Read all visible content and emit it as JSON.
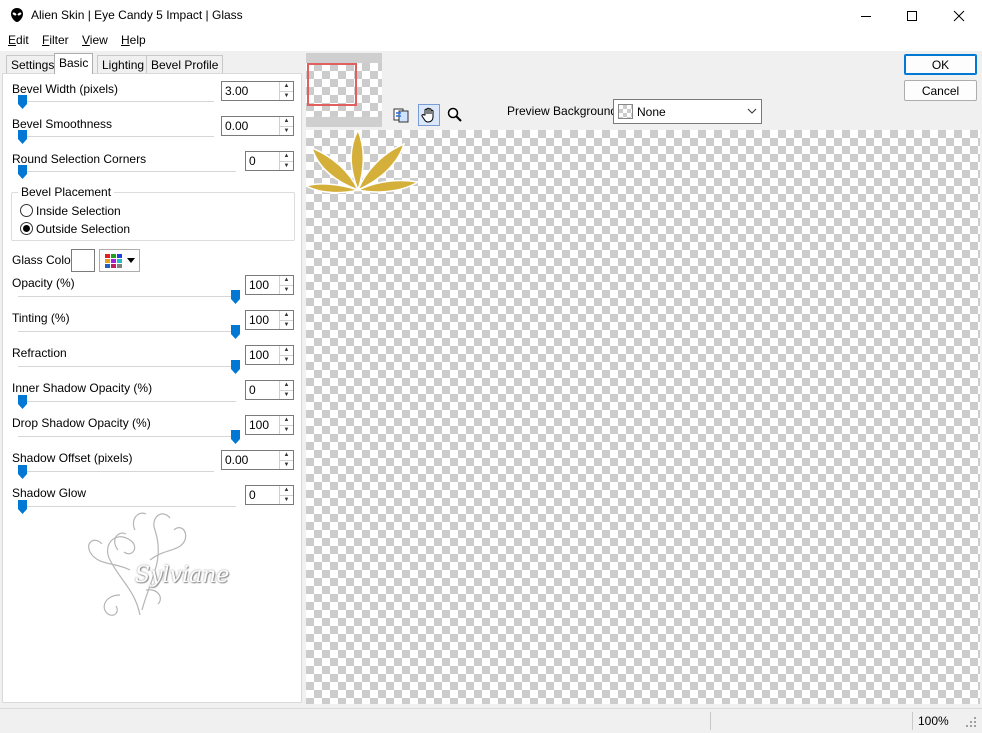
{
  "window": {
    "title": "Alien Skin | Eye Candy 5 Impact | Glass",
    "minimize_icon": "minimize-icon",
    "maximize_icon": "maximize-icon",
    "close_icon": "close-icon"
  },
  "menu": {
    "items": [
      {
        "label": "Edit",
        "mnemonic": "E",
        "rest": "dit"
      },
      {
        "label": "Filter",
        "mnemonic": "F",
        "rest": "ilter"
      },
      {
        "label": "View",
        "mnemonic": "V",
        "rest": "iew"
      },
      {
        "label": "Help",
        "mnemonic": "H",
        "rest": "elp"
      }
    ]
  },
  "tabs": [
    {
      "label": "Settings",
      "active": false
    },
    {
      "label": "Basic",
      "active": true
    },
    {
      "label": "Lighting",
      "active": false
    },
    {
      "label": "Bevel Profile",
      "active": false
    }
  ],
  "controls": {
    "bevel_width": {
      "label": "Bevel Width (pixels)",
      "value": "3.00",
      "slider_fraction": 0.0
    },
    "bevel_smoothness": {
      "label": "Bevel Smoothness",
      "value": "0.00",
      "slider_fraction": 0.0
    },
    "round_corners": {
      "label": "Round Selection Corners",
      "value": "0",
      "slider_fraction": 0.0
    },
    "bevel_placement": {
      "title": "Bevel Placement",
      "options": [
        {
          "label": "Inside Selection",
          "selected": false
        },
        {
          "label": "Outside Selection",
          "selected": true
        }
      ]
    },
    "glass_color": {
      "label": "Glass Color",
      "swatch": "#ffffff"
    },
    "opacity": {
      "label": "Opacity (%)",
      "value": "100",
      "slider_fraction": 1.0
    },
    "tinting": {
      "label": "Tinting (%)",
      "value": "100",
      "slider_fraction": 1.0
    },
    "refraction": {
      "label": "Refraction",
      "value": "100",
      "slider_fraction": 1.0
    },
    "inner_shadow_opacity": {
      "label": "Inner Shadow Opacity (%)",
      "value": "0",
      "slider_fraction": 0.0
    },
    "drop_shadow_opacity": {
      "label": "Drop Shadow Opacity (%)",
      "value": "100",
      "slider_fraction": 1.0
    },
    "shadow_offset": {
      "label": "Shadow Offset (pixels)",
      "value": "0.00",
      "slider_fraction": 0.0
    },
    "shadow_glow": {
      "label": "Shadow Glow",
      "value": "0",
      "slider_fraction": 0.0
    }
  },
  "watermark": {
    "text": "Sylviane"
  },
  "buttons": {
    "ok": "OK",
    "cancel": "Cancel"
  },
  "preview": {
    "background_label": "Preview Background:",
    "background_value": "None"
  },
  "status": {
    "zoom": "100%"
  },
  "colors": {
    "accent": "#0078d4",
    "thumbnail_frame": "#e06060",
    "gold": "#d4b03a"
  }
}
